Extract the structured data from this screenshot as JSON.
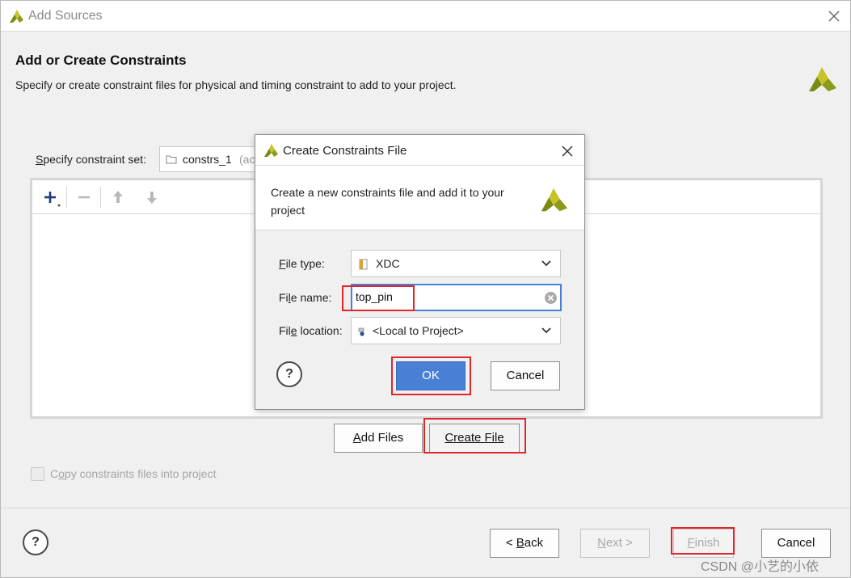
{
  "window": {
    "title": "Add Sources"
  },
  "header": {
    "title": "Add or Create Constraints",
    "description": "Specify or create constraint files for physical and timing constraint to add to your project."
  },
  "constraint_set": {
    "label_prefix": "S",
    "label_rest": "pecify constraint set:",
    "value": "constrs_1",
    "value_suffix": "(ac"
  },
  "buttons": {
    "add_files_prefix": "A",
    "add_files_rest": "dd Files",
    "create_file_prefix": "C",
    "create_file_rest": "reate File",
    "back_prefix": "< ",
    "back_u": "B",
    "back_rest": "ack",
    "next_u": "N",
    "next_rest": "ext >",
    "finish_u": "F",
    "finish_rest": "inish",
    "cancel": "Cancel",
    "help": "?"
  },
  "copy_option": {
    "label_prefix": "C",
    "label_u": "o",
    "label_rest": "py constraints files into project",
    "checked": false
  },
  "dialog": {
    "title": "Create Constraints File",
    "description": "Create a new constraints file and add it to your project",
    "file_type": {
      "label_u": "F",
      "label_rest": "ile type:",
      "value": "XDC"
    },
    "file_name": {
      "label_pre": "Fi",
      "label_u": "l",
      "label_rest": "e name:",
      "value": "top_pin"
    },
    "file_location": {
      "label_pre": "Fil",
      "label_u": "e",
      "label_rest": " location:",
      "value": "<Local to Project>"
    },
    "ok": "OK",
    "cancel": "Cancel",
    "help": "?"
  },
  "colors": {
    "accent": "#4a7fd6",
    "highlight": "#e0262b",
    "logo_green": "#7a8a12",
    "logo_yellow": "#c7c42a"
  },
  "watermark": "CSDN @小艺的小依"
}
